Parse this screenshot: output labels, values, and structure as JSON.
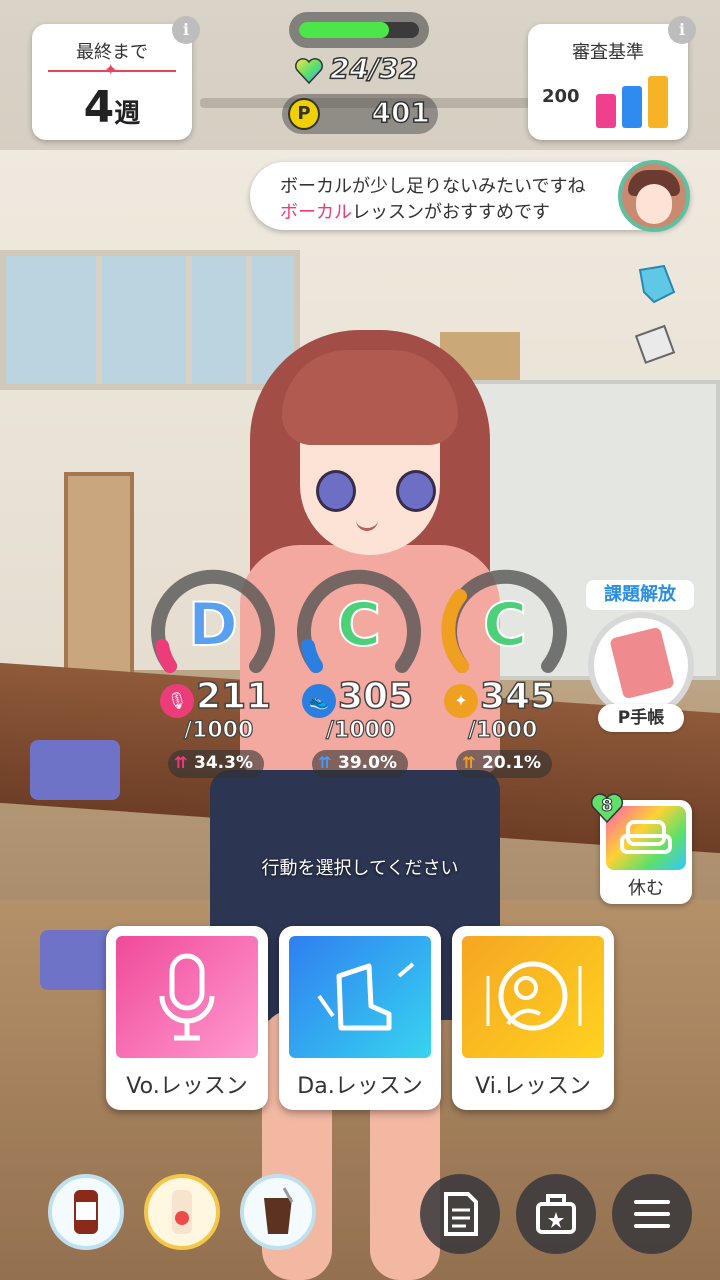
{
  "weeks": {
    "label": "最終まで",
    "value": "4",
    "unit": "週"
  },
  "criteria": {
    "label": "審査基準",
    "value": "200",
    "bar_colors": [
      "#ef3f8e",
      "#2f8bf0",
      "#f5b325"
    ]
  },
  "stamina": {
    "current": 24,
    "max": 32,
    "display": "24/32",
    "fill_fraction": 0.75
  },
  "p_points": {
    "icon": "P",
    "value": "401"
  },
  "advice": {
    "line1": "ボーカルが少し足りないみたいですね",
    "line2_highlight": "ボーカル",
    "line2_rest": "レッスンがおすすめです"
  },
  "stats": [
    {
      "key": "vo",
      "grade": "D",
      "value": "211",
      "max": "/1000",
      "growth": "34.3%",
      "color": "#ec3d7a",
      "icon": "microphone-icon",
      "glyph": "🎙"
    },
    {
      "key": "da",
      "grade": "C",
      "value": "305",
      "max": "/1000",
      "growth": "39.0%",
      "color": "#2b7fe0",
      "icon": "dance-shoe-icon",
      "glyph": "👟"
    },
    {
      "key": "vi",
      "grade": "C",
      "value": "345",
      "max": "/1000",
      "growth": "20.1%",
      "color": "#f0a020",
      "icon": "visual-icon",
      "glyph": "✦"
    }
  ],
  "task": {
    "label": "課題解放",
    "pbook_label": "P手帳"
  },
  "rest": {
    "label": "休む",
    "badge": "8"
  },
  "prompt": "行動を選択してください",
  "lessons": [
    {
      "label": "Vo.レッスン",
      "color_a": "#f04a9a",
      "color_b": "#ff9bd0",
      "icon": "microphone-icon"
    },
    {
      "label": "Da.レッスン",
      "color_a": "#2f7ff0",
      "color_b": "#37d4f0",
      "icon": "dance-shoe-icon"
    },
    {
      "label": "Vi.レッスン",
      "color_a": "#f5a623",
      "color_b": "#ffd21f",
      "icon": "visual-icon"
    }
  ],
  "drinks": [
    "oolong-tea-drink-icon",
    "strawberry-milk-drink-icon",
    "iced-coffee-drink-icon"
  ],
  "menu_buttons": [
    "document-icon",
    "bag-icon",
    "menu-icon"
  ]
}
